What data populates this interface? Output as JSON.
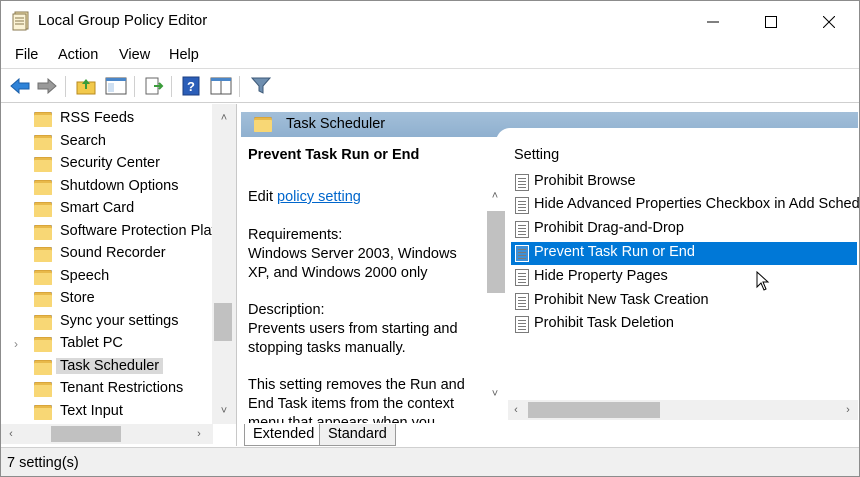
{
  "window": {
    "title": "Local Group Policy Editor"
  },
  "menu": {
    "file": "File",
    "action": "Action",
    "view": "View",
    "help": "Help"
  },
  "tree": {
    "items": [
      {
        "label": "RSS Feeds",
        "expandable": false
      },
      {
        "label": "Search",
        "expandable": false
      },
      {
        "label": "Security Center",
        "expandable": false
      },
      {
        "label": "Shutdown Options",
        "expandable": false
      },
      {
        "label": "Smart Card",
        "expandable": false
      },
      {
        "label": "Software Protection Plat",
        "expandable": false
      },
      {
        "label": "Sound Recorder",
        "expandable": false
      },
      {
        "label": "Speech",
        "expandable": false
      },
      {
        "label": "Store",
        "expandable": false
      },
      {
        "label": "Sync your settings",
        "expandable": false
      },
      {
        "label": "Tablet PC",
        "expandable": true
      },
      {
        "label": "Task Scheduler",
        "expandable": false,
        "selected": true
      },
      {
        "label": "Tenant Restrictions",
        "expandable": false
      },
      {
        "label": "Text Input",
        "expandable": false
      }
    ]
  },
  "details": {
    "header": "Task Scheduler",
    "description": {
      "title": "Prevent Task Run or End",
      "edit_prefix": "Edit ",
      "edit_link": "policy setting",
      "requirements_label": "Requirements:",
      "requirements_line1": "Windows Server 2003, Windows",
      "requirements_line2": "XP, and Windows 2000 only",
      "description_label": "Description:",
      "description_line1": "Prevents users from starting and",
      "description_line2": "stopping tasks manually.",
      "more_line1": "This setting removes the Run and",
      "more_line2": "End Task items from the context",
      "more_line3": "menu that appears when you"
    },
    "settings_column": "Setting",
    "settings": [
      {
        "label": "Prohibit Browse"
      },
      {
        "label": "Hide Advanced Properties Checkbox in Add Sched"
      },
      {
        "label": "Prohibit Drag-and-Drop"
      },
      {
        "label": "Prevent Task Run or End",
        "selected": true
      },
      {
        "label": "Hide Property Pages"
      },
      {
        "label": "Prohibit New Task Creation"
      },
      {
        "label": "Prohibit Task Deletion"
      }
    ],
    "tabs": {
      "extended": "Extended",
      "standard": "Standard"
    }
  },
  "status": {
    "text": "7 setting(s)"
  },
  "colors": {
    "selection": "#0078d7",
    "header_band": "#9bb9d6",
    "link": "#0066cc"
  }
}
